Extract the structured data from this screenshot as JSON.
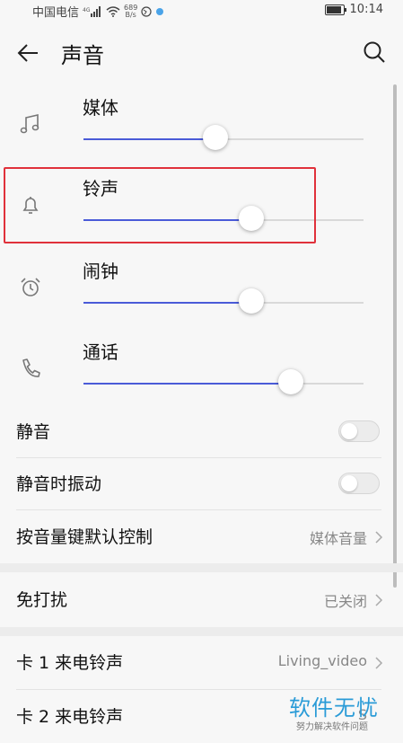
{
  "statusbar": {
    "carrier": "中国电信",
    "net_speed_value": "689",
    "net_speed_unit": "B/s",
    "time": "10:14"
  },
  "appbar": {
    "title": "声音",
    "back_icon": "arrow-left-icon",
    "search_icon": "search-icon"
  },
  "volumes": [
    {
      "label": "媒体",
      "icon": "music-note-icon",
      "level": 0.47
    },
    {
      "label": "铃声",
      "icon": "bell-icon",
      "level": 0.6
    },
    {
      "label": "闹钟",
      "icon": "alarm-clock-icon",
      "level": 0.6
    },
    {
      "label": "通话",
      "icon": "phone-icon",
      "level": 0.74
    }
  ],
  "settings": {
    "mute": {
      "label": "静音",
      "on": false
    },
    "vibrate_when_muted": {
      "label": "静音时振动",
      "on": false
    },
    "volume_key_default": {
      "label": "按音量键默认控制",
      "value": "媒体音量"
    },
    "do_not_disturb": {
      "label": "免打扰",
      "value": "已关闭"
    },
    "sim1_ringtone": {
      "label": "卡 1 来电铃声",
      "value": "Living_video"
    },
    "sim2_ringtone": {
      "label": "卡 2 来电铃声",
      "value": "S"
    }
  },
  "watermark": {
    "title": "软件无忧",
    "subtitle": "努力解决软件问题"
  },
  "colors": {
    "accent": "#4a5bd8",
    "highlight": "#e0313b",
    "watermark": "#2a9bd7"
  }
}
